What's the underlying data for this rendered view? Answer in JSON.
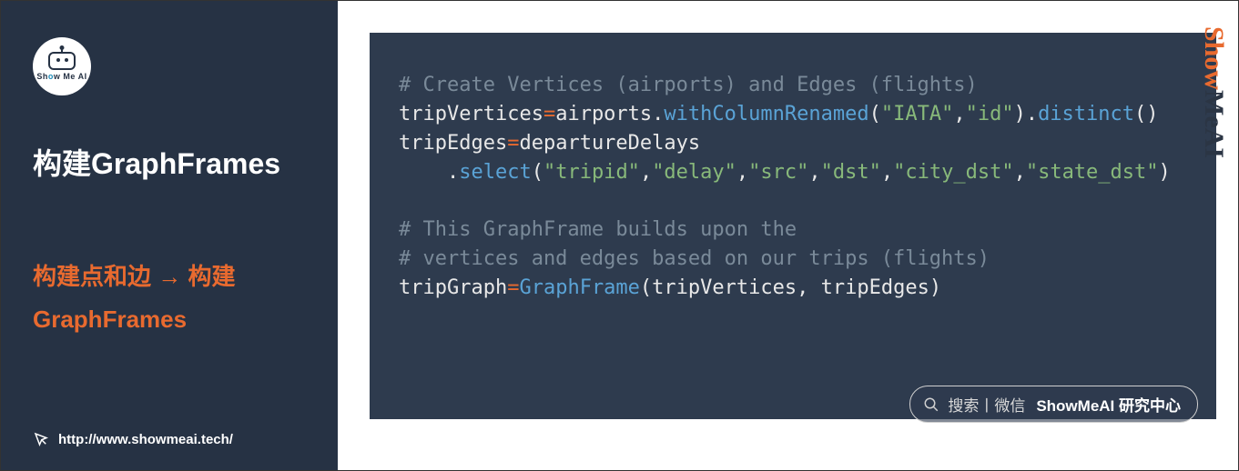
{
  "sidebar": {
    "logo_text_plain": "Sh",
    "logo_text_accent": "o",
    "logo_text_rest": "w Me AI",
    "title": "构建GraphFrames",
    "subtitle_line1": "构建点和边 → 构建",
    "subtitle_line2": "GraphFrames",
    "footer_url": "http://www.showmeai.tech/"
  },
  "watermark": {
    "orange": "Show",
    "dark": "MeAI"
  },
  "code": {
    "tokens": [
      {
        "cls": "c-comment",
        "t": "# Create Vertices (airports) and Edges (flights)"
      },
      {
        "cls": "br"
      },
      {
        "cls": "c-default",
        "t": "tripVertices"
      },
      {
        "cls": "c-op",
        "t": "="
      },
      {
        "cls": "c-default",
        "t": "airports"
      },
      {
        "cls": "c-punct",
        "t": "."
      },
      {
        "cls": "c-method",
        "t": "withColumnRenamed"
      },
      {
        "cls": "c-punct",
        "t": "("
      },
      {
        "cls": "c-string",
        "t": "\"IATA\""
      },
      {
        "cls": "c-punct",
        "t": ","
      },
      {
        "cls": "c-string",
        "t": "\"id\""
      },
      {
        "cls": "c-punct",
        "t": ")."
      },
      {
        "cls": "c-method",
        "t": "distinct"
      },
      {
        "cls": "c-punct",
        "t": "()"
      },
      {
        "cls": "br"
      },
      {
        "cls": "c-default",
        "t": "tripEdges"
      },
      {
        "cls": "c-op",
        "t": "="
      },
      {
        "cls": "c-default",
        "t": "departureDelays"
      },
      {
        "cls": "br"
      },
      {
        "cls": "c-default",
        "t": "    "
      },
      {
        "cls": "c-punct",
        "t": "."
      },
      {
        "cls": "c-method",
        "t": "select"
      },
      {
        "cls": "c-punct",
        "t": "("
      },
      {
        "cls": "c-string",
        "t": "\"tripid\""
      },
      {
        "cls": "c-punct",
        "t": ","
      },
      {
        "cls": "c-string",
        "t": "\"delay\""
      },
      {
        "cls": "c-punct",
        "t": ","
      },
      {
        "cls": "c-string",
        "t": "\"src\""
      },
      {
        "cls": "c-punct",
        "t": ","
      },
      {
        "cls": "c-string",
        "t": "\"dst\""
      },
      {
        "cls": "c-punct",
        "t": ","
      },
      {
        "cls": "c-string",
        "t": "\"city_dst\""
      },
      {
        "cls": "c-punct",
        "t": ","
      },
      {
        "cls": "c-string",
        "t": "\"state_dst\""
      },
      {
        "cls": "c-punct",
        "t": ")"
      },
      {
        "cls": "br"
      },
      {
        "cls": "br"
      },
      {
        "cls": "c-comment",
        "t": "# This GraphFrame builds upon the"
      },
      {
        "cls": "br"
      },
      {
        "cls": "c-comment",
        "t": "# vertices and edges based on our trips (flights)"
      },
      {
        "cls": "br"
      },
      {
        "cls": "c-default",
        "t": "tripGraph"
      },
      {
        "cls": "c-op",
        "t": "="
      },
      {
        "cls": "c-method",
        "t": "GraphFrame"
      },
      {
        "cls": "c-punct",
        "t": "("
      },
      {
        "cls": "c-default",
        "t": "tripVertices"
      },
      {
        "cls": "c-punct",
        "t": ", "
      },
      {
        "cls": "c-default",
        "t": "tripEdges"
      },
      {
        "cls": "c-punct",
        "t": ")"
      }
    ]
  },
  "searchbox": {
    "prefix": "搜索丨微信",
    "bold": "ShowMeAI 研究中心"
  }
}
